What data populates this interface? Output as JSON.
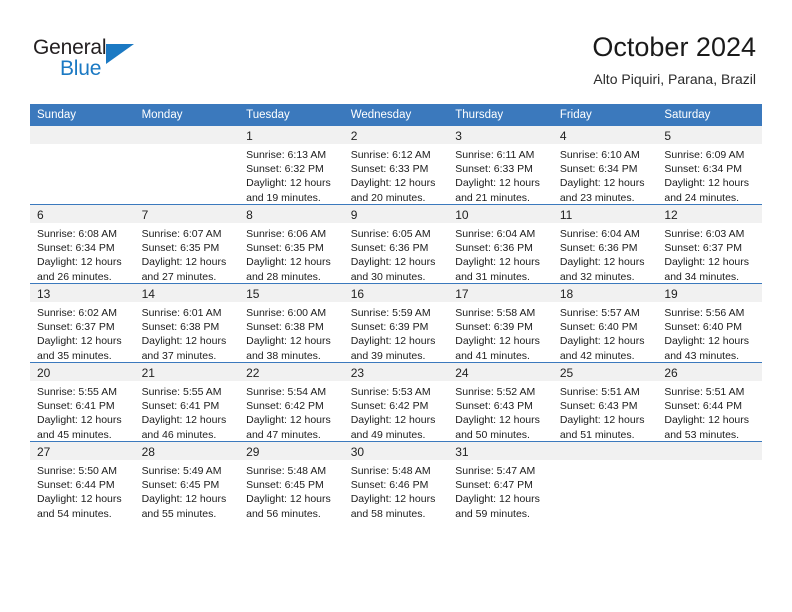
{
  "brand": {
    "logo_text_top": "General",
    "logo_text_bottom": "Blue",
    "logo_icon": "blue-triangle",
    "color_primary": "#1b79c3",
    "color_dark": "#231f20"
  },
  "header": {
    "title": "October 2024",
    "subtitle": "Alto Piquiri, Parana, Brazil"
  },
  "calendar": {
    "header_bg": "#3b79bd",
    "daynum_bg": "#f1f1f1",
    "weekday_headers": [
      "Sunday",
      "Monday",
      "Tuesday",
      "Wednesday",
      "Thursday",
      "Friday",
      "Saturday"
    ],
    "weeks": [
      [
        {
          "day": "",
          "lines": []
        },
        {
          "day": "",
          "lines": []
        },
        {
          "day": "1",
          "lines": [
            "Sunrise: 6:13 AM",
            "Sunset: 6:32 PM",
            "Daylight: 12 hours",
            "and 19 minutes."
          ]
        },
        {
          "day": "2",
          "lines": [
            "Sunrise: 6:12 AM",
            "Sunset: 6:33 PM",
            "Daylight: 12 hours",
            "and 20 minutes."
          ]
        },
        {
          "day": "3",
          "lines": [
            "Sunrise: 6:11 AM",
            "Sunset: 6:33 PM",
            "Daylight: 12 hours",
            "and 21 minutes."
          ]
        },
        {
          "day": "4",
          "lines": [
            "Sunrise: 6:10 AM",
            "Sunset: 6:34 PM",
            "Daylight: 12 hours",
            "and 23 minutes."
          ]
        },
        {
          "day": "5",
          "lines": [
            "Sunrise: 6:09 AM",
            "Sunset: 6:34 PM",
            "Daylight: 12 hours",
            "and 24 minutes."
          ]
        }
      ],
      [
        {
          "day": "6",
          "lines": [
            "Sunrise: 6:08 AM",
            "Sunset: 6:34 PM",
            "Daylight: 12 hours",
            "and 26 minutes."
          ]
        },
        {
          "day": "7",
          "lines": [
            "Sunrise: 6:07 AM",
            "Sunset: 6:35 PM",
            "Daylight: 12 hours",
            "and 27 minutes."
          ]
        },
        {
          "day": "8",
          "lines": [
            "Sunrise: 6:06 AM",
            "Sunset: 6:35 PM",
            "Daylight: 12 hours",
            "and 28 minutes."
          ]
        },
        {
          "day": "9",
          "lines": [
            "Sunrise: 6:05 AM",
            "Sunset: 6:36 PM",
            "Daylight: 12 hours",
            "and 30 minutes."
          ]
        },
        {
          "day": "10",
          "lines": [
            "Sunrise: 6:04 AM",
            "Sunset: 6:36 PM",
            "Daylight: 12 hours",
            "and 31 minutes."
          ]
        },
        {
          "day": "11",
          "lines": [
            "Sunrise: 6:04 AM",
            "Sunset: 6:36 PM",
            "Daylight: 12 hours",
            "and 32 minutes."
          ]
        },
        {
          "day": "12",
          "lines": [
            "Sunrise: 6:03 AM",
            "Sunset: 6:37 PM",
            "Daylight: 12 hours",
            "and 34 minutes."
          ]
        }
      ],
      [
        {
          "day": "13",
          "lines": [
            "Sunrise: 6:02 AM",
            "Sunset: 6:37 PM",
            "Daylight: 12 hours",
            "and 35 minutes."
          ]
        },
        {
          "day": "14",
          "lines": [
            "Sunrise: 6:01 AM",
            "Sunset: 6:38 PM",
            "Daylight: 12 hours",
            "and 37 minutes."
          ]
        },
        {
          "day": "15",
          "lines": [
            "Sunrise: 6:00 AM",
            "Sunset: 6:38 PM",
            "Daylight: 12 hours",
            "and 38 minutes."
          ]
        },
        {
          "day": "16",
          "lines": [
            "Sunrise: 5:59 AM",
            "Sunset: 6:39 PM",
            "Daylight: 12 hours",
            "and 39 minutes."
          ]
        },
        {
          "day": "17",
          "lines": [
            "Sunrise: 5:58 AM",
            "Sunset: 6:39 PM",
            "Daylight: 12 hours",
            "and 41 minutes."
          ]
        },
        {
          "day": "18",
          "lines": [
            "Sunrise: 5:57 AM",
            "Sunset: 6:40 PM",
            "Daylight: 12 hours",
            "and 42 minutes."
          ]
        },
        {
          "day": "19",
          "lines": [
            "Sunrise: 5:56 AM",
            "Sunset: 6:40 PM",
            "Daylight: 12 hours",
            "and 43 minutes."
          ]
        }
      ],
      [
        {
          "day": "20",
          "lines": [
            "Sunrise: 5:55 AM",
            "Sunset: 6:41 PM",
            "Daylight: 12 hours",
            "and 45 minutes."
          ]
        },
        {
          "day": "21",
          "lines": [
            "Sunrise: 5:55 AM",
            "Sunset: 6:41 PM",
            "Daylight: 12 hours",
            "and 46 minutes."
          ]
        },
        {
          "day": "22",
          "lines": [
            "Sunrise: 5:54 AM",
            "Sunset: 6:42 PM",
            "Daylight: 12 hours",
            "and 47 minutes."
          ]
        },
        {
          "day": "23",
          "lines": [
            "Sunrise: 5:53 AM",
            "Sunset: 6:42 PM",
            "Daylight: 12 hours",
            "and 49 minutes."
          ]
        },
        {
          "day": "24",
          "lines": [
            "Sunrise: 5:52 AM",
            "Sunset: 6:43 PM",
            "Daylight: 12 hours",
            "and 50 minutes."
          ]
        },
        {
          "day": "25",
          "lines": [
            "Sunrise: 5:51 AM",
            "Sunset: 6:43 PM",
            "Daylight: 12 hours",
            "and 51 minutes."
          ]
        },
        {
          "day": "26",
          "lines": [
            "Sunrise: 5:51 AM",
            "Sunset: 6:44 PM",
            "Daylight: 12 hours",
            "and 53 minutes."
          ]
        }
      ],
      [
        {
          "day": "27",
          "lines": [
            "Sunrise: 5:50 AM",
            "Sunset: 6:44 PM",
            "Daylight: 12 hours",
            "and 54 minutes."
          ]
        },
        {
          "day": "28",
          "lines": [
            "Sunrise: 5:49 AM",
            "Sunset: 6:45 PM",
            "Daylight: 12 hours",
            "and 55 minutes."
          ]
        },
        {
          "day": "29",
          "lines": [
            "Sunrise: 5:48 AM",
            "Sunset: 6:45 PM",
            "Daylight: 12 hours",
            "and 56 minutes."
          ]
        },
        {
          "day": "30",
          "lines": [
            "Sunrise: 5:48 AM",
            "Sunset: 6:46 PM",
            "Daylight: 12 hours",
            "and 58 minutes."
          ]
        },
        {
          "day": "31",
          "lines": [
            "Sunrise: 5:47 AM",
            "Sunset: 6:47 PM",
            "Daylight: 12 hours",
            "and 59 minutes."
          ]
        },
        {
          "day": "",
          "lines": []
        },
        {
          "day": "",
          "lines": []
        }
      ]
    ]
  }
}
